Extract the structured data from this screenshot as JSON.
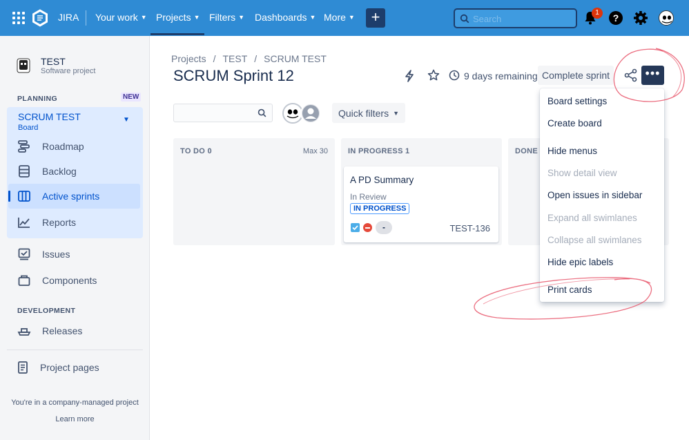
{
  "topnav": {
    "app_name": "JIRA",
    "items": [
      {
        "label": "Your work"
      },
      {
        "label": "Projects"
      },
      {
        "label": "Filters"
      },
      {
        "label": "Dashboards"
      },
      {
        "label": "More"
      }
    ],
    "create_label": "+",
    "search_placeholder": "Search",
    "notification_count": "1",
    "help_label": "?"
  },
  "sidebar": {
    "project_name": "TEST",
    "project_type": "Software project",
    "planning_title": "PLANNING",
    "new_badge": "NEW",
    "board_name": "SCRUM TEST",
    "board_sub": "Board",
    "planning_items": [
      {
        "label": "Roadmap"
      },
      {
        "label": "Backlog"
      },
      {
        "label": "Active sprints"
      },
      {
        "label": "Reports"
      }
    ],
    "other_items": [
      {
        "label": "Issues"
      },
      {
        "label": "Components"
      }
    ],
    "development_title": "DEVELOPMENT",
    "development_items": [
      {
        "label": "Releases"
      }
    ],
    "project_pages": "Project pages",
    "footer": "You're in a company-managed project",
    "learn_more": "Learn more"
  },
  "main": {
    "breadcrumbs": [
      "Projects",
      "/",
      "TEST",
      "/",
      "SCRUM TEST"
    ],
    "title": "SCRUM Sprint 12",
    "remaining": "9 days remaining",
    "complete_sprint": "Complete sprint",
    "more_label": "•••",
    "quick_filters": "Quick filters",
    "columns": [
      {
        "title": "TO DO  0",
        "max": "Max 30"
      },
      {
        "title": "IN PROGRESS  1",
        "max": ""
      },
      {
        "title": "DONE  0",
        "max": ""
      }
    ],
    "card": {
      "title": "A PD Summary",
      "status": "In Review",
      "lozenge": "IN PROGRESS",
      "estimate": "-",
      "key": "TEST-136"
    }
  },
  "dropdown": {
    "items": [
      {
        "label": "Board settings",
        "enabled": true
      },
      {
        "label": "Create board",
        "enabled": true
      },
      {
        "label": "Hide menus",
        "enabled": true
      },
      {
        "label": "Show detail view",
        "enabled": false
      },
      {
        "label": "Open issues in sidebar",
        "enabled": true
      },
      {
        "label": "Expand all swimlanes",
        "enabled": false
      },
      {
        "label": "Collapse all swimlanes",
        "enabled": false
      },
      {
        "label": "Hide epic labels",
        "enabled": true
      },
      {
        "label": "Print cards",
        "enabled": true
      }
    ]
  },
  "colors": {
    "nav_bg": "#2f8bd4",
    "accent": "#0052cc",
    "annotation": "#e8556a"
  }
}
